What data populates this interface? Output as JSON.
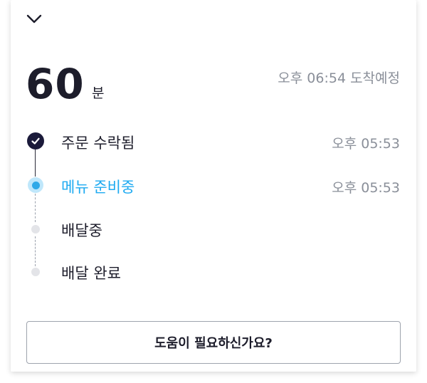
{
  "eta": {
    "minutes": "60",
    "unit": "분",
    "arrival": "오후 06:54 도착예정"
  },
  "steps": [
    {
      "label": "주문 수락됨",
      "time": "오후 05:53",
      "state": "done"
    },
    {
      "label": "메뉴 준비중",
      "time": "오후 05:53",
      "state": "active"
    },
    {
      "label": "배달중",
      "time": "",
      "state": "pending"
    },
    {
      "label": "배달 완료",
      "time": "",
      "state": "pending"
    }
  ],
  "help_button": {
    "label": "도움이 필요하신가요?"
  },
  "icons": {
    "collapse": "chevron-down-icon",
    "check": "check-icon"
  },
  "colors": {
    "accent": "#1eaaf1",
    "done": "#1b1a3a",
    "muted": "#8a8f99"
  }
}
